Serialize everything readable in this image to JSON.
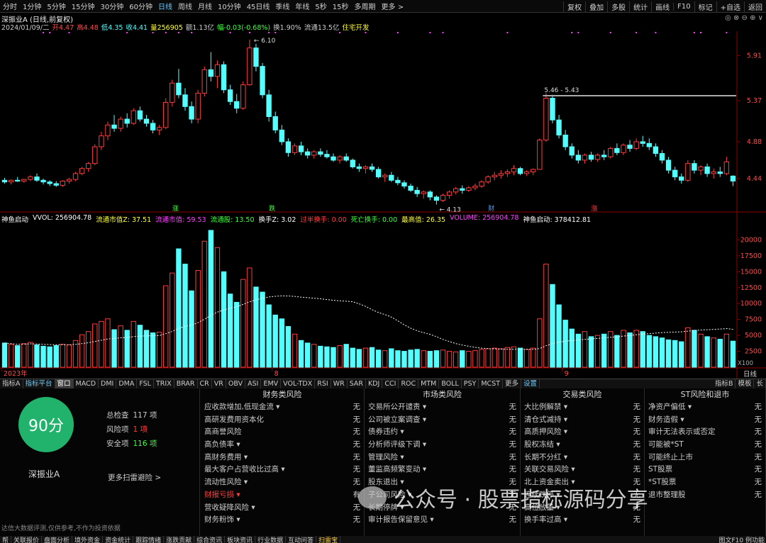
{
  "toolbar": {
    "left": [
      "分时",
      "1分钟",
      "5分钟",
      "15分钟",
      "30分钟",
      "60分钟",
      "日线",
      "周线",
      "月线",
      "10分钟",
      "45日线",
      "季线",
      "年线",
      "5秒",
      "15秒",
      "多周期",
      "更多 >"
    ],
    "active_index": 6,
    "right": [
      "复权",
      "叠加",
      "多股",
      "统计",
      "画线",
      "F10",
      "标记",
      "+自选",
      "返回"
    ]
  },
  "stock": {
    "title": "深振业A (日线,前复权)",
    "win_controls": "◎ ⊗ ⊖ ⊕ ∨"
  },
  "quote": {
    "date": "2024/01/09/二",
    "open": "开4.47",
    "high": "高4.48",
    "low": "低4.35",
    "close": "收4.41",
    "volume": "量256905",
    "amount": "额1.13亿",
    "change": "幅-0.03(-0.68%)",
    "turnover": "换1.90%",
    "float_mv": "流通13.5亿",
    "concept": "住宅开发"
  },
  "price_axis": [
    "5.91",
    "5.37",
    "4.88",
    "4.44"
  ],
  "price_annotations": {
    "high": "6.10",
    "low": "4.13",
    "hline": "5.46 - 5.43"
  },
  "event_tags": [
    "涨",
    "跌",
    "财",
    "涨"
  ],
  "indicator": {
    "name": "神鱼启动",
    "vvol": "VVOL: 256904.78",
    "lt_mv_z": "流通市值Z: 37.51",
    "lt_mv": "流通市值: 59.53",
    "lt_gu": "流通股: 13.50",
    "hs_z": "换手Z: 3.02",
    "over_half": "过半换手: 0.00",
    "dead": "死亡换手: 0.00",
    "maxv": "最高值: 26.35",
    "volume": "VOLUME: 256904.78",
    "qidong": "神鱼启动: 378412.81"
  },
  "vol_axis": [
    "20000",
    "17500",
    "15000",
    "12500",
    "10000",
    "7500",
    "5000",
    "2500"
  ],
  "vol_unit": "X100",
  "period_label": "日线",
  "time_axis": [
    "2023年",
    "8",
    "9",
    "10",
    "11",
    "12",
    "1"
  ],
  "tabs": [
    "指标A",
    "指标平台",
    "窗口",
    "MACD",
    "DMI",
    "DMA",
    "FSL",
    "TRIX",
    "BRAR",
    "CR",
    "VR",
    "OBV",
    "ASI",
    "EMV",
    "VOL-TDX",
    "RSI",
    "WR",
    "SAR",
    "KDJ",
    "CCI",
    "ROC",
    "MTM",
    "BOLL",
    "PSY",
    "MCST",
    "更多",
    "设置"
  ],
  "tabs_right": [
    "指标B",
    "模板",
    "长"
  ],
  "score": {
    "value": "90分",
    "stock": "深振业A",
    "total_label": "总检查",
    "total": "117 项",
    "risk_label": "风险项",
    "risk": "1 项",
    "safe_label": "安全项",
    "safe": "116 项",
    "more": "更多扫雷避险 >",
    "disclaimer": "达信大数据评测,仅供参考,不作为投资依据"
  },
  "risk_columns": [
    {
      "title": "财务类风险",
      "items": [
        {
          "label": "应收款增加,低现金流 ▾",
          "status": "无"
        },
        {
          "label": "高研发费用资本化",
          "status": "无"
        },
        {
          "label": "高商誉风险",
          "status": "无"
        },
        {
          "label": "高负债率 ▾",
          "status": "无"
        },
        {
          "label": "高财务费用 ▾",
          "status": "无"
        },
        {
          "label": "最大客户占营收比过高 ▾",
          "status": "无"
        },
        {
          "label": "流动性风险 ▾",
          "status": "无"
        },
        {
          "label": "财报亏损 ▾",
          "status": "有",
          "alert": true
        },
        {
          "label": "营收疑降风险 ▾",
          "status": "无"
        },
        {
          "label": "财务粉饰 ▾",
          "status": "无"
        }
      ]
    },
    {
      "title": "市场类风险",
      "items": [
        {
          "label": "交易所公开谴责 ▾",
          "status": "无"
        },
        {
          "label": "公司被立案调查 ▾",
          "status": "无"
        },
        {
          "label": "债券违约 ▾",
          "status": "无"
        },
        {
          "label": "分析师评级下调 ▾",
          "status": "无"
        },
        {
          "label": "管理风险 ▾",
          "status": "无"
        },
        {
          "label": "董监高频繁变动 ▾",
          "status": "无"
        },
        {
          "label": "股东退出 ▾",
          "status": "无"
        },
        {
          "label": "子公司风险 ▾",
          "status": "无"
        },
        {
          "label": "长期停牌 ▾",
          "status": "无"
        },
        {
          "label": "审计报告保留意见 ▾",
          "status": "无"
        }
      ]
    },
    {
      "title": "交易类风险",
      "items": [
        {
          "label": "大比例解禁 ▾",
          "status": "无"
        },
        {
          "label": "清仓式减持 ▾",
          "status": "无"
        },
        {
          "label": "高质押风险 ▾",
          "status": "无"
        },
        {
          "label": "股权冻结 ▾",
          "status": "无"
        },
        {
          "label": "长期不分红 ▾",
          "status": "无"
        },
        {
          "label": "关联交易风险 ▾",
          "status": "无"
        },
        {
          "label": "北上资金卖出 ▾",
          "status": "无"
        },
        {
          "label": "连续跌停 ▾",
          "status": "无"
        },
        {
          "label": "高位放量 ▾",
          "status": "无"
        },
        {
          "label": "换手率过高 ▾",
          "status": "无"
        }
      ]
    },
    {
      "title": "ST风险和退市",
      "items": [
        {
          "label": "净资产偏低 ▾",
          "status": "无"
        },
        {
          "label": "财务造假 ▾",
          "status": "无"
        },
        {
          "label": "审计无法表示或否定",
          "status": "无"
        },
        {
          "label": "可能被*ST",
          "status": "无"
        },
        {
          "label": "可能终止上市",
          "status": "无"
        },
        {
          "label": "ST股票",
          "status": "无"
        },
        {
          "label": "*ST股票",
          "status": "无"
        },
        {
          "label": "退市整理股",
          "status": "无"
        },
        {
          "label": "",
          "status": ""
        },
        {
          "label": "",
          "status": ""
        }
      ]
    }
  ],
  "bottombar": [
    "帮",
    "关联报价",
    "盘面分析",
    "境外资金",
    "资金统计",
    "跟踪情绪",
    "涨跌贡献",
    "综合资讯",
    "板块资讯",
    "行业数据",
    "互动问答",
    "扫雷宝"
  ],
  "bottombar_right": "图文F10 例功能",
  "watermark": "公众号 · 股票指标源码分享",
  "colors": {
    "up": "#ff3c3c",
    "down": "#54ffff",
    "ma": "#ffffff",
    "score": "#21b36b"
  },
  "chart_data": {
    "type": "candlestick",
    "ylim_price": [
      4.05,
      6.2
    ],
    "ylim_volume": [
      0,
      22500
    ],
    "candles": [
      [
        4.42,
        4.45,
        4.38,
        4.4
      ],
      [
        4.4,
        4.43,
        4.37,
        4.42
      ],
      [
        4.42,
        4.46,
        4.4,
        4.41
      ],
      [
        4.41,
        4.44,
        4.39,
        4.43
      ],
      [
        4.43,
        4.48,
        4.41,
        4.46
      ],
      [
        4.46,
        4.5,
        4.4,
        4.42
      ],
      [
        4.42,
        4.44,
        4.37,
        4.4
      ],
      [
        4.4,
        4.42,
        4.35,
        4.38
      ],
      [
        4.38,
        4.41,
        4.34,
        4.36
      ],
      [
        4.36,
        4.42,
        4.34,
        4.41
      ],
      [
        4.41,
        4.45,
        4.38,
        4.43
      ],
      [
        4.43,
        4.52,
        4.41,
        4.5
      ],
      [
        4.5,
        4.58,
        4.48,
        4.56
      ],
      [
        4.56,
        4.64,
        4.52,
        4.62
      ],
      [
        4.62,
        4.85,
        4.6,
        4.82
      ],
      [
        4.82,
        5.0,
        4.78,
        4.95
      ],
      [
        4.95,
        5.12,
        4.9,
        5.08
      ],
      [
        5.08,
        5.2,
        5.0,
        5.04
      ],
      [
        5.04,
        5.18,
        5.0,
        5.15
      ],
      [
        5.15,
        5.22,
        5.05,
        5.1
      ],
      [
        5.1,
        5.28,
        5.08,
        5.25
      ],
      [
        5.25,
        5.3,
        5.12,
        5.15
      ],
      [
        5.15,
        5.2,
        5.06,
        5.1
      ],
      [
        5.1,
        5.14,
        4.98,
        5.02
      ],
      [
        5.02,
        5.08,
        4.96,
        5.05
      ],
      [
        5.05,
        5.4,
        5.03,
        5.35
      ],
      [
        5.35,
        5.62,
        5.3,
        5.58
      ],
      [
        5.58,
        5.75,
        5.4,
        5.44
      ],
      [
        5.44,
        5.52,
        5.25,
        5.3
      ],
      [
        5.3,
        5.36,
        5.1,
        5.15
      ],
      [
        5.15,
        5.5,
        5.1,
        5.46
      ],
      [
        5.46,
        5.78,
        5.42,
        5.74
      ],
      [
        5.74,
        5.95,
        5.6,
        5.66
      ],
      [
        5.66,
        5.85,
        5.52,
        5.8
      ],
      [
        5.8,
        5.84,
        5.46,
        5.5
      ],
      [
        5.5,
        5.56,
        5.32,
        5.36
      ],
      [
        5.36,
        5.45,
        5.22,
        5.28
      ],
      [
        5.28,
        5.6,
        5.26,
        5.56
      ],
      [
        5.56,
        6.1,
        5.55,
        6.0
      ],
      [
        6.0,
        6.05,
        5.72,
        5.78
      ],
      [
        5.78,
        5.82,
        5.4,
        5.44
      ],
      [
        5.44,
        5.5,
        5.12,
        5.18
      ],
      [
        5.18,
        5.24,
        4.98,
        5.02
      ],
      [
        5.02,
        5.08,
        4.84,
        4.88
      ],
      [
        4.88,
        4.92,
        4.7,
        4.75
      ],
      [
        4.75,
        4.86,
        4.72,
        4.83
      ],
      [
        4.83,
        4.88,
        4.72,
        4.76
      ],
      [
        4.76,
        4.8,
        4.68,
        4.72
      ],
      [
        4.72,
        4.78,
        4.68,
        4.76
      ],
      [
        4.76,
        4.8,
        4.7,
        4.73
      ],
      [
        4.73,
        4.78,
        4.68,
        4.7
      ],
      [
        4.7,
        4.74,
        4.64,
        4.66
      ],
      [
        4.66,
        4.72,
        4.62,
        4.7
      ],
      [
        4.7,
        4.74,
        4.64,
        4.66
      ],
      [
        4.66,
        4.68,
        4.56,
        4.58
      ],
      [
        4.58,
        4.62,
        4.52,
        4.56
      ],
      [
        4.56,
        4.6,
        4.5,
        4.58
      ],
      [
        4.58,
        4.62,
        4.52,
        4.55
      ],
      [
        4.55,
        4.58,
        4.44,
        4.46
      ],
      [
        4.46,
        4.5,
        4.4,
        4.48
      ],
      [
        4.48,
        4.52,
        4.4,
        4.42
      ],
      [
        4.42,
        4.46,
        4.36,
        4.39
      ],
      [
        4.39,
        4.42,
        4.32,
        4.35
      ],
      [
        4.35,
        4.38,
        4.28,
        4.3
      ],
      [
        4.3,
        4.34,
        4.22,
        4.26
      ],
      [
        4.26,
        4.3,
        4.2,
        4.28
      ],
      [
        4.28,
        4.3,
        4.18,
        4.22
      ],
      [
        4.22,
        4.24,
        4.13,
        4.18
      ],
      [
        4.18,
        4.26,
        4.16,
        4.24
      ],
      [
        4.24,
        4.3,
        4.2,
        4.28
      ],
      [
        4.28,
        4.34,
        4.25,
        4.32
      ],
      [
        4.32,
        4.36,
        4.26,
        4.3
      ],
      [
        4.3,
        4.35,
        4.28,
        4.33
      ],
      [
        4.33,
        4.38,
        4.3,
        4.35
      ],
      [
        4.35,
        4.42,
        4.33,
        4.4
      ],
      [
        4.4,
        4.48,
        4.38,
        4.46
      ],
      [
        4.46,
        4.52,
        4.42,
        4.48
      ],
      [
        4.48,
        4.54,
        4.44,
        4.5
      ],
      [
        4.5,
        4.55,
        4.46,
        4.52
      ],
      [
        4.52,
        4.6,
        4.48,
        4.56
      ],
      [
        4.56,
        4.58,
        4.48,
        4.5
      ],
      [
        4.5,
        4.54,
        4.47,
        4.52
      ],
      [
        4.52,
        4.56,
        4.48,
        4.55
      ],
      [
        4.55,
        4.92,
        4.55,
        4.9
      ],
      [
        4.9,
        5.46,
        4.88,
        5.4
      ],
      [
        5.4,
        5.44,
        5.1,
        5.14
      ],
      [
        5.14,
        5.2,
        4.92,
        4.96
      ],
      [
        4.96,
        5.02,
        4.78,
        4.82
      ],
      [
        4.82,
        4.86,
        4.68,
        4.72
      ],
      [
        4.72,
        4.78,
        4.62,
        4.66
      ],
      [
        4.66,
        4.74,
        4.62,
        4.72
      ],
      [
        4.72,
        4.76,
        4.64,
        4.67
      ],
      [
        4.67,
        4.74,
        4.64,
        4.72
      ],
      [
        4.72,
        4.78,
        4.66,
        4.7
      ],
      [
        4.7,
        4.82,
        4.68,
        4.8
      ],
      [
        4.8,
        4.86,
        4.72,
        4.75
      ],
      [
        4.75,
        4.86,
        4.72,
        4.84
      ],
      [
        4.84,
        4.9,
        4.76,
        4.8
      ],
      [
        4.8,
        4.92,
        4.78,
        4.88
      ],
      [
        4.88,
        4.95,
        4.82,
        4.86
      ],
      [
        4.86,
        4.92,
        4.78,
        4.82
      ],
      [
        4.82,
        4.86,
        4.7,
        4.74
      ],
      [
        4.74,
        4.78,
        4.62,
        4.66
      ],
      [
        4.66,
        4.7,
        4.5,
        4.54
      ],
      [
        4.54,
        4.58,
        4.42,
        4.46
      ],
      [
        4.46,
        4.5,
        4.38,
        4.42
      ],
      [
        4.42,
        4.66,
        4.4,
        4.62
      ],
      [
        4.62,
        4.66,
        4.5,
        4.54
      ],
      [
        4.54,
        4.6,
        4.48,
        4.58
      ],
      [
        4.58,
        4.62,
        4.46,
        4.5
      ],
      [
        4.5,
        4.56,
        4.44,
        4.52
      ],
      [
        4.52,
        4.58,
        4.46,
        4.5
      ],
      [
        4.5,
        4.7,
        4.48,
        4.64
      ],
      [
        4.47,
        4.48,
        4.35,
        4.41
      ]
    ],
    "volumes": [
      3800,
      3600,
      3400,
      3700,
      3900,
      3500,
      3300,
      3200,
      3400,
      3600,
      3500,
      4200,
      5100,
      5600,
      6800,
      7200,
      7600,
      5900,
      6500,
      5800,
      7200,
      6600,
      5800,
      5400,
      5500,
      12800,
      14800,
      18600,
      16200,
      12000,
      15200,
      19800,
      21500,
      18800,
      15000,
      11500,
      10200,
      13800,
      15600,
      12600,
      11800,
      9800,
      8200,
      7600,
      6400,
      5200,
      4200,
      3800,
      3600,
      3300,
      3200,
      3100,
      3400,
      3600,
      3000,
      2800,
      3000,
      3100,
      2700,
      2600,
      2900,
      2600,
      2500,
      2700,
      2800,
      2600,
      2500,
      2600,
      2700,
      2500,
      2400,
      2600,
      2500,
      2600,
      2800,
      2900,
      3000,
      2900,
      3100,
      3200,
      3000,
      2800,
      3000,
      7600,
      16200,
      13000,
      9800,
      7400,
      6000,
      5200,
      5600,
      4800,
      5000,
      5200,
      5600,
      5000,
      5800,
      5400,
      5800,
      5600,
      5000,
      4800,
      4600,
      4300,
      4200,
      4000,
      6200,
      5800,
      5200,
      4800,
      4600,
      4400,
      5200,
      4100
    ]
  }
}
